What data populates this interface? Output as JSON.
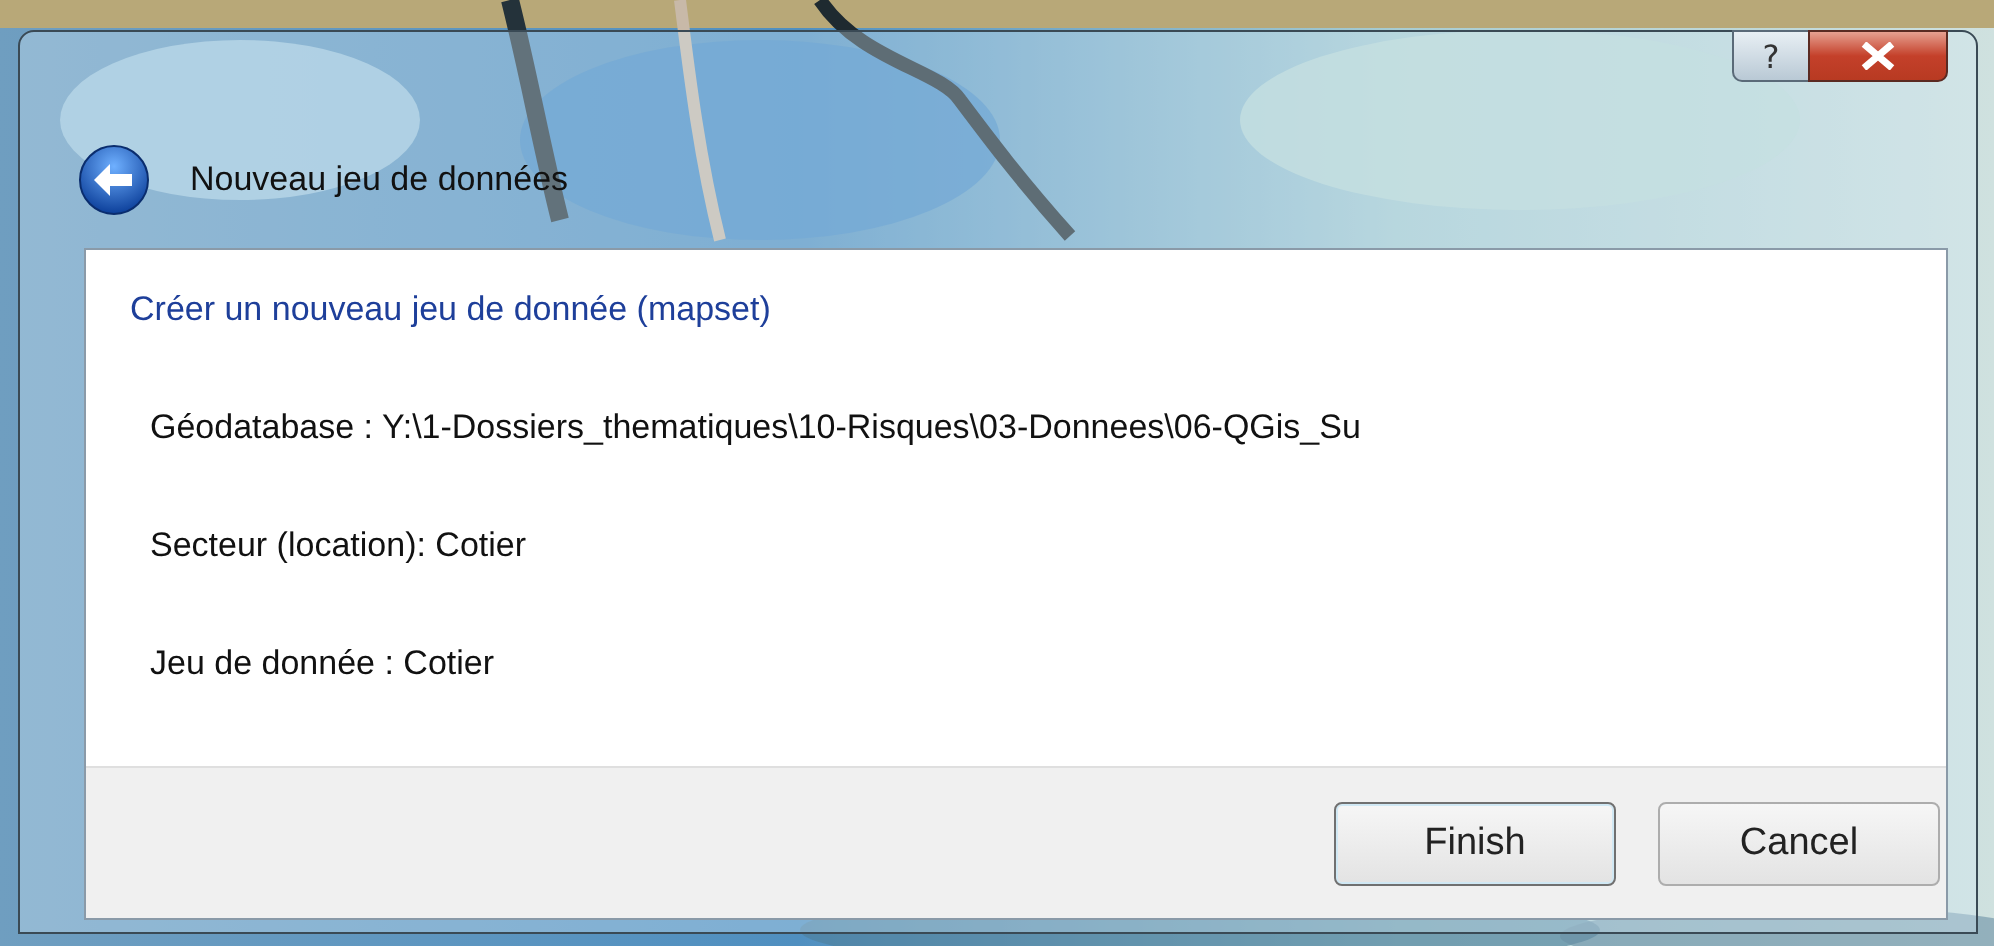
{
  "window": {
    "title": "Nouveau jeu de données",
    "help_button": "?"
  },
  "heading": "Créer un nouveau jeu de donnée (mapset)",
  "lines": [
    "Géodatabase : Y:\\1-Dossiers_thematiques\\10-Risques\\03-Donnees\\06-QGis_Su",
    "Secteur (location): Cotier",
    "Jeu de donnée : Cotier"
  ],
  "buttons": [
    {
      "label": "Finish",
      "default": true
    },
    {
      "label": "Cancel",
      "default": false
    }
  ]
}
